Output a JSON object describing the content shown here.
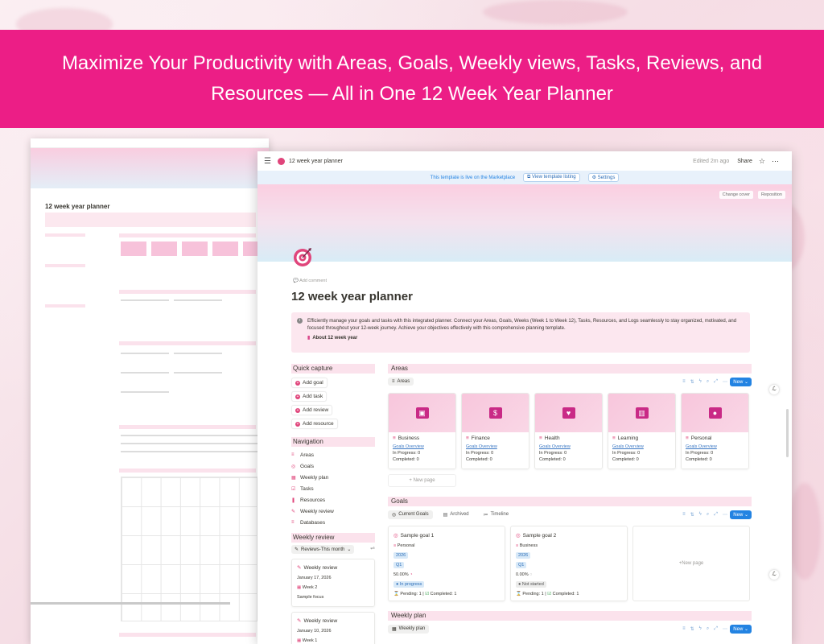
{
  "banner": {
    "line1": "Maximize Your Productivity with Areas, Goals, Weekly views, Tasks, Reviews, and",
    "line2": "Resources — All in One 12 Week Year Planner"
  },
  "mini": {
    "title": "12 week year planner"
  },
  "topbar": {
    "title": "12 week year planner",
    "edited": "Edited 2m ago",
    "share": "Share"
  },
  "marketplace": {
    "notice": "This template is live on the Marketplace",
    "view_listing": "View template listing",
    "settings": "Settings"
  },
  "hero": {
    "change_cover": "Change cover",
    "reposition": "Reposition"
  },
  "page": {
    "add_comment": "Add comment",
    "title": "12 week year planner",
    "callout": "Efficiently manage your goals and tasks with this integrated planner. Connect your Areas, Goals, Weeks (Week 1 to Week 12), Tasks, Resources, and Logs seamlessly to stay organized, motivated, and focused throughout your 12-week journey. Achieve your objectives effectively with this comprehensive planning template.",
    "about": "About 12 week year"
  },
  "sidebar": {
    "quick_capture": "Quick capture",
    "quick": [
      "Add goal",
      "Add task",
      "Add review",
      "Add resource"
    ],
    "navigation": "Navigation",
    "nav": [
      {
        "icon": "≡",
        "label": "Areas"
      },
      {
        "icon": "◎",
        "label": "Goals"
      },
      {
        "icon": "▦",
        "label": "Weekly plan"
      },
      {
        "icon": "☑",
        "label": "Tasks"
      },
      {
        "icon": "❚",
        "label": "Resources"
      },
      {
        "icon": "✎",
        "label": "Weekly review"
      },
      {
        "icon": "≡",
        "label": "Databases"
      }
    ],
    "weekly_review": "Weekly review",
    "review_view": "Reviews-This month",
    "reviews": [
      {
        "title": "Weekly review",
        "date": "January 17, 2026",
        "week": "Week 2",
        "focus": "Sample focus"
      },
      {
        "title": "Weekly review",
        "date": "January 10, 2026",
        "week": "Week 1"
      }
    ]
  },
  "areas": {
    "header": "Areas",
    "view": "Areas",
    "new": "New",
    "items": [
      {
        "name": "Business",
        "icon": "briefcase",
        "glyph": "▣"
      },
      {
        "name": "Finance",
        "icon": "money-bag",
        "glyph": "$"
      },
      {
        "name": "Health",
        "icon": "heart",
        "glyph": "♥"
      },
      {
        "name": "Learning",
        "icon": "book",
        "glyph": "▥"
      },
      {
        "name": "Personal",
        "icon": "person",
        "glyph": "●"
      }
    ],
    "overview_label": "Goals Overview",
    "in_progress": "In Progress: 0",
    "completed": "Completed: 0",
    "new_page": "New page"
  },
  "goals": {
    "header": "Goals",
    "tabs": [
      "Current Goals",
      "Archived",
      "Timeline"
    ],
    "new": "New",
    "items": [
      {
        "title": "Sample goal 1",
        "area": "Personal",
        "year": "2026",
        "quarter": "Q1",
        "progress": "50.00%",
        "status": "In progress",
        "pending": "Pending: 1",
        "completed": "Completed: 1"
      },
      {
        "title": "Sample goal 2",
        "area": "Business",
        "year": "2026",
        "quarter": "Q1",
        "progress": "0.00%",
        "status": "Not started",
        "pending": "Pending: 1",
        "completed": "Completed: 1"
      }
    ],
    "new_page": "New page"
  },
  "weekly_plan": {
    "header": "Weekly plan",
    "view": "Weekly plan",
    "new": "New"
  },
  "colors": {
    "banner": "#ec1e86",
    "accent": "#e0457b",
    "section_bg": "#fbe2ec",
    "new_button": "#2383e2"
  }
}
